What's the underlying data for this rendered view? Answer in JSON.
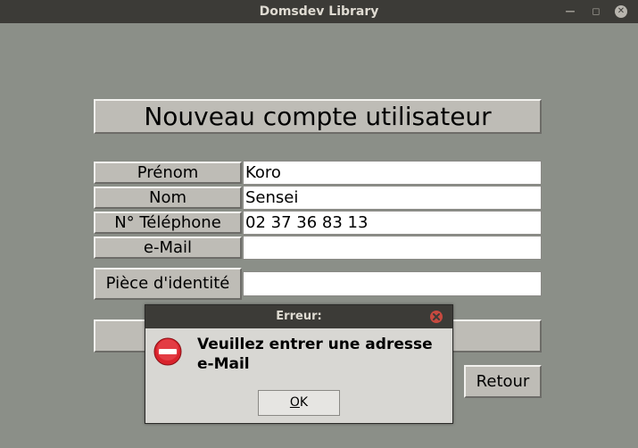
{
  "window": {
    "title": "Domsdev Library"
  },
  "form": {
    "heading": "Nouveau compte utilisateur",
    "fields": [
      {
        "label": "Prénom",
        "value": "Koro"
      },
      {
        "label": "Nom",
        "value": "Sensei"
      },
      {
        "label": "N° Téléphone",
        "value": "02 37 36 83 13"
      },
      {
        "label": "e-Mail",
        "value": ""
      }
    ],
    "id_button_label": "Pièce d'identité",
    "id_value": "",
    "back_button_label": "Retour"
  },
  "dialog": {
    "title": "Erreur:",
    "message": "Veuillez entrer une adresse e-Mail",
    "ok_label_underlined": "O",
    "ok_label_rest": "K"
  },
  "colors": {
    "background": "#8b8f88",
    "titlebar": "#3c3b37",
    "panel": "#bebcb6",
    "error_red": "#d9232c"
  }
}
